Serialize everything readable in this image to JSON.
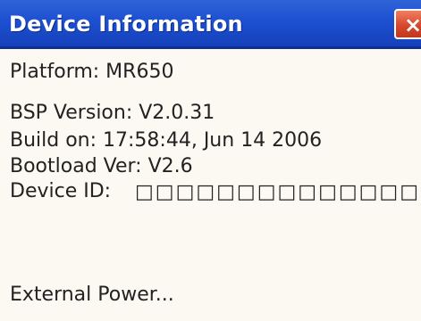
{
  "window": {
    "title": "Device Information",
    "close_icon": "close-icon"
  },
  "details": {
    "platform": "Platform: MR650",
    "bsp_version": "BSP Version: V2.0.31",
    "build_on": "Build on: 17:58:44, Jun 14 2006",
    "bootload_ver": "Bootload Ver: V2.6",
    "device_id_label": "Device ID:",
    "device_id_value": "□□□□□□□□□□□□□□",
    "external_power": "External Power..."
  },
  "colors": {
    "titlebar": "#1c4fd0",
    "close_button": "#d9472c",
    "background": "#fbf9f1",
    "text": "#222222"
  }
}
